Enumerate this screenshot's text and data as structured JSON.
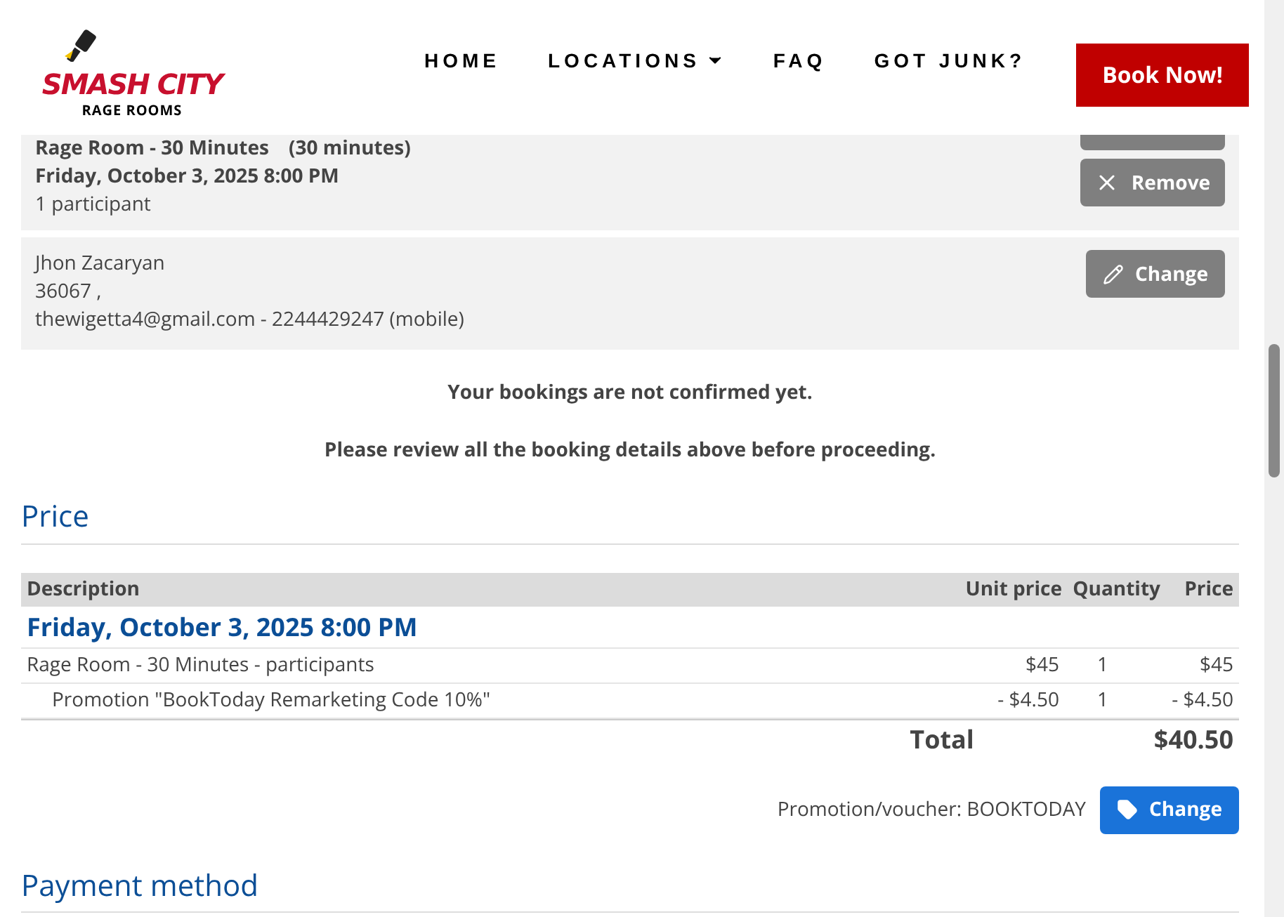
{
  "header": {
    "logo": {
      "title": "SMASH CITY",
      "subtitle": "RAGE ROOMS"
    },
    "nav": [
      {
        "label": "HOME",
        "has_menu": false
      },
      {
        "label": "LOCATIONS",
        "has_menu": true
      },
      {
        "label": "FAQ",
        "has_menu": false
      },
      {
        "label": "GOT JUNK?",
        "has_menu": false
      }
    ],
    "cta": "Book Now!"
  },
  "booking": {
    "service": "Rage Room - 30 Minutes",
    "duration": "(30 minutes)",
    "date": "Friday, October 3, 2025 8:00 PM",
    "participants": "1 participant",
    "remove_button": "Remove"
  },
  "customer": {
    "name": "Jhon Zacaryan",
    "address": "36067 ,",
    "contact": "thewigetta4@gmail.com - 2244429247 (mobile)",
    "change_button": "Change"
  },
  "notices": [
    "Your bookings are not confirmed yet.",
    "Please review all the booking details above before proceeding."
  ],
  "price": {
    "heading": "Price",
    "columns": [
      "Description",
      "Unit price",
      "Quantity",
      "Price"
    ],
    "group": "Friday, October 3, 2025 8:00 PM",
    "rows": [
      {
        "kind": "item",
        "description": "Rage Room - 30 Minutes - participants",
        "unit_price": "$45",
        "quantity": "1",
        "price": "$45"
      },
      {
        "kind": "promotion",
        "description": "Promotion \"BookToday Remarketing Code 10%\"",
        "unit_price": "- $4.50",
        "quantity": "1",
        "price": "- $4.50"
      }
    ],
    "total_label": "Total",
    "total": "$40.50",
    "voucher": "Promotion/voucher: BOOKTODAY",
    "voucher_button": "Change"
  },
  "payment": {
    "heading": "Payment method"
  }
}
